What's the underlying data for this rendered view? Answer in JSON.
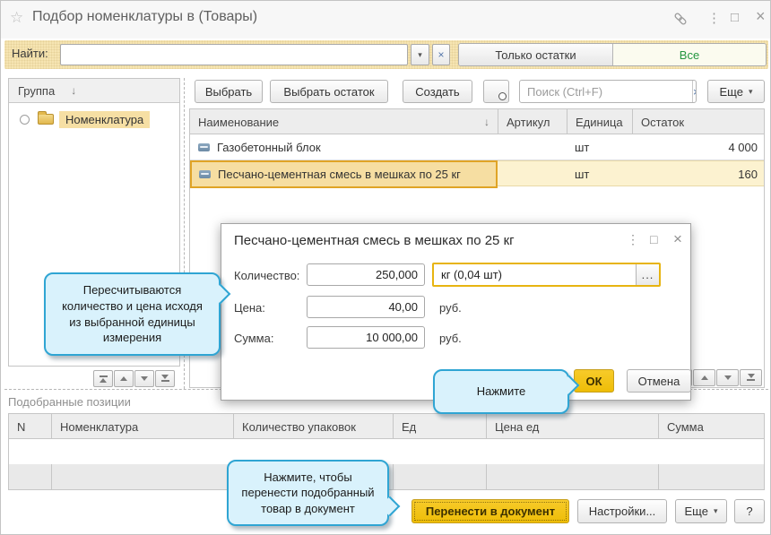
{
  "window": {
    "title": "Подбор номенклатуры в (Товары)"
  },
  "icons": {
    "favorite": "☆",
    "menu_dots": "⋮",
    "maximize": "□",
    "close": "×",
    "dropdown": "▾",
    "clear": "×",
    "sort_down": "↓",
    "modal_dots": "⋮",
    "modal_maximize": "□",
    "modal_close": "×"
  },
  "search_band": {
    "label": "Найти:",
    "input_value": "",
    "only_stock_label": "Только остатки",
    "all_label": "Все"
  },
  "left_panel": {
    "header": "Группа",
    "tree_item": "Номенклатура"
  },
  "toolbar": {
    "select": "Выбрать",
    "select_stock": "Выбрать остаток",
    "create": "Создать",
    "search_placeholder": "Поиск (Ctrl+F)",
    "more": "Еще"
  },
  "items_table": {
    "columns": [
      "Наименование",
      "Артикул",
      "Единица",
      "Остаток"
    ],
    "rows": [
      {
        "name": "Газобетонный блок",
        "article": "",
        "unit": "шт",
        "stock": "4 000"
      },
      {
        "name": "Песчано-цементная смесь в мешках по 25 кг",
        "article": "",
        "unit": "шт",
        "stock": "160"
      }
    ]
  },
  "modal": {
    "title": "Песчано-цементная смесь в мешках по 25 кг",
    "quantity_label": "Количество:",
    "quantity_value": "250,000",
    "unit_value": "кг (0,04 шт)",
    "unit_more_label": "...",
    "price_label": "Цена:",
    "price_value": "40,00",
    "price_currency": "руб.",
    "sum_label": "Сумма:",
    "sum_value": "10 000,00",
    "sum_currency": "руб.",
    "ok_label": "ОК",
    "cancel_label": "Отмена"
  },
  "callouts": {
    "recalc": "Пересчитываются количество и цена исходя из выбранной единицы измерения",
    "press_ok": "Нажмите",
    "press_transfer": "Нажмите, чтобы перенести подобранный товар в документ"
  },
  "selected_section": {
    "title": "Подобранные позиции",
    "columns": [
      "N",
      "Номенклатура",
      "Количество упаковок",
      "Ед",
      "Цена ед",
      "Сумма"
    ]
  },
  "footer": {
    "transfer": "Перенести в документ",
    "settings": "Настройки...",
    "more": "Еще",
    "help": "?"
  },
  "colors": {
    "accent_gold": "#eebd07",
    "callout_blue": "#2fa5d3",
    "selection_yellow": "#f6dea2",
    "band_yellow": "#f6e5b2",
    "all_green": "#23963f"
  }
}
